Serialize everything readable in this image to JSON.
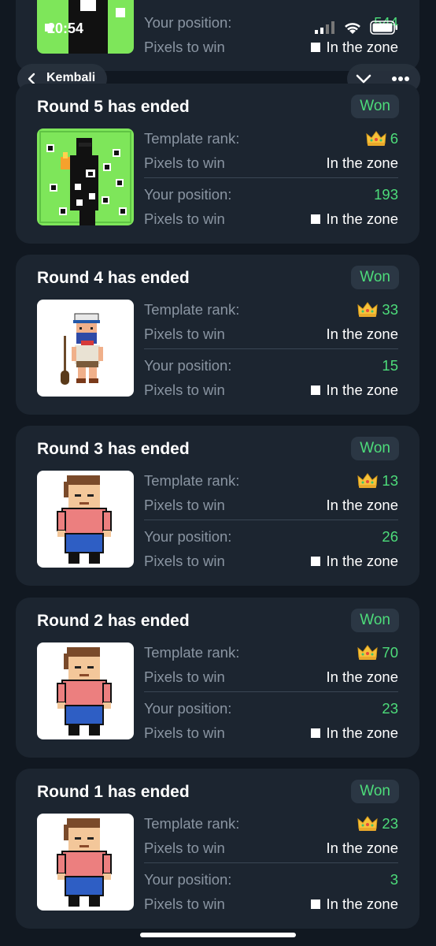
{
  "status_bar": {
    "time": "20:54"
  },
  "nav": {
    "back_label": "Kembali"
  },
  "top_partial": {
    "rows": [
      {
        "label": "Your position:",
        "value": "544"
      },
      {
        "label": "Pixels to win",
        "value": "In the zone"
      }
    ]
  },
  "rounds": [
    {
      "title": "Round 5 has ended",
      "badge": "Won",
      "template_rank_label": "Template rank:",
      "template_rank": "6",
      "pixels_label_1": "Pixels to win",
      "pixels_value_1": "In the zone",
      "position_label": "Your position:",
      "position": "193",
      "pixels_label_2": "Pixels to win",
      "pixels_value_2": "In the zone",
      "thumb": "green"
    },
    {
      "title": "Round 4 has ended",
      "badge": "Won",
      "template_rank_label": "Template rank:",
      "template_rank": "33",
      "pixels_label_1": "Pixels to win",
      "pixels_value_1": "In the zone",
      "position_label": "Your position:",
      "position": "15",
      "pixels_label_2": "Pixels to win",
      "pixels_value_2": "In the zone",
      "thumb": "sailor"
    },
    {
      "title": "Round 3 has ended",
      "badge": "Won",
      "template_rank_label": "Template rank:",
      "template_rank": "13",
      "pixels_label_1": "Pixels to win",
      "pixels_value_1": "In the zone",
      "position_label": "Your position:",
      "position": "26",
      "pixels_label_2": "Pixels to win",
      "pixels_value_2": "In the zone",
      "thumb": "person"
    },
    {
      "title": "Round 2 has ended",
      "badge": "Won",
      "template_rank_label": "Template rank:",
      "template_rank": "70",
      "pixels_label_1": "Pixels to win",
      "pixels_value_1": "In the zone",
      "position_label": "Your position:",
      "position": "23",
      "pixels_label_2": "Pixels to win",
      "pixels_value_2": "In the zone",
      "thumb": "person"
    },
    {
      "title": "Round 1 has ended",
      "badge": "Won",
      "template_rank_label": "Template rank:",
      "template_rank": "23",
      "pixels_label_1": "Pixels to win",
      "pixels_value_1": "In the zone",
      "position_label": "Your position:",
      "position": "3",
      "pixels_label_2": "Pixels to win",
      "pixels_value_2": "In the zone",
      "thumb": "person"
    }
  ],
  "colors": {
    "background": "#111821",
    "card": "#1c2530",
    "accent_green": "#4ddc7a",
    "muted_label": "#8a95a2"
  },
  "icons": [
    "back-chevron-icon",
    "chevron-down-icon",
    "more-dots-icon",
    "crown-icon",
    "signal-icon",
    "wifi-icon",
    "battery-icon"
  ]
}
